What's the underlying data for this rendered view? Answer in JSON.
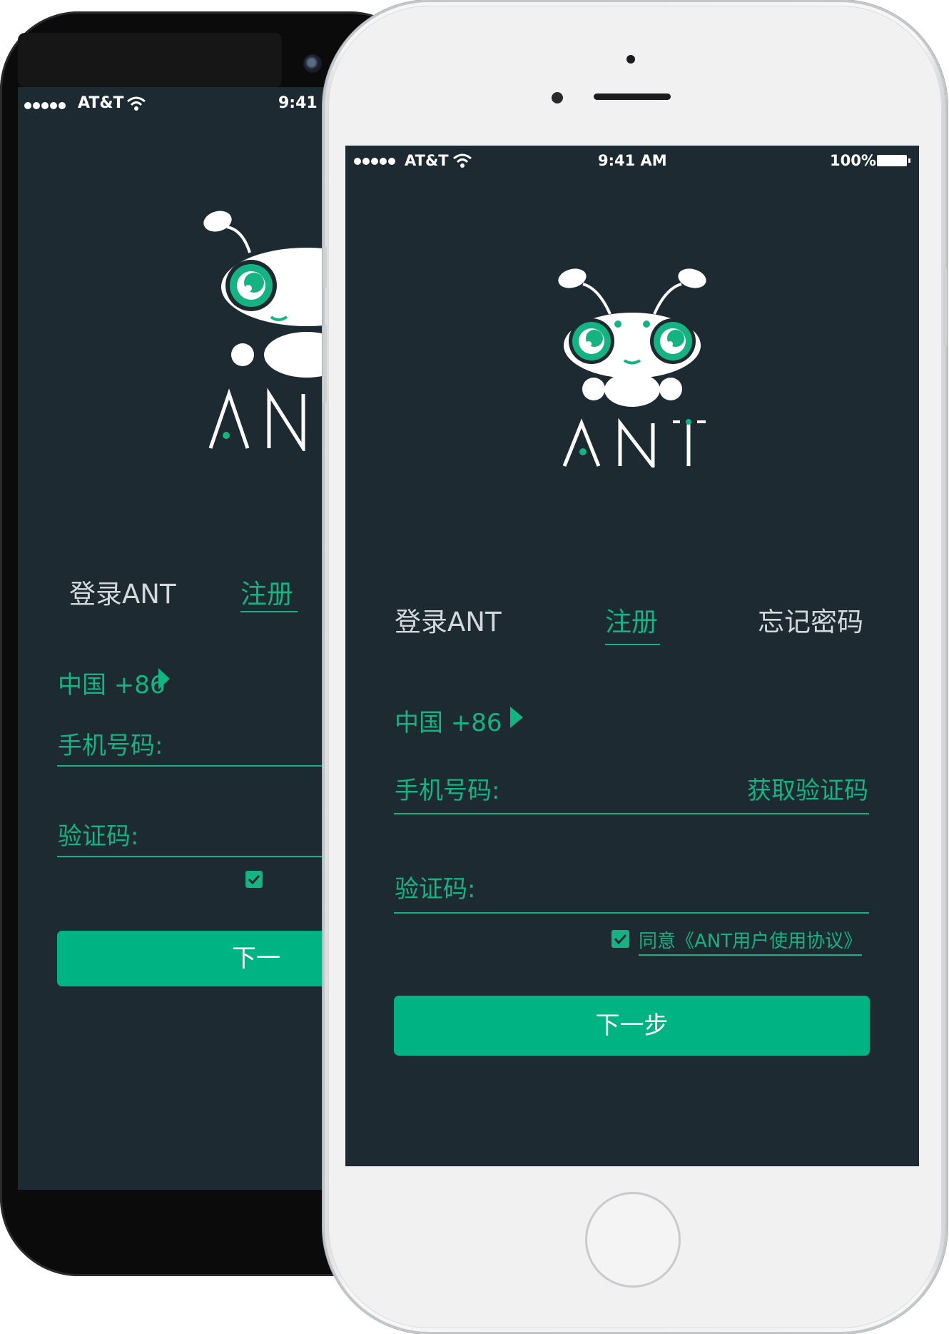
{
  "back_phone": {
    "status": {
      "carrier": "AT&T",
      "time": "9:41"
    },
    "logo_text": "AN",
    "tabs": {
      "login": "登录ANT",
      "register": "注册"
    },
    "country": "中国 +86",
    "phone_label": "手机号码:",
    "code_label": "验证码:",
    "next_button": "下一"
  },
  "front_phone": {
    "status": {
      "carrier": "AT&T",
      "time": "9:41 AM",
      "battery": "100%"
    },
    "logo_text": "ANT",
    "tabs": {
      "login": "登录ANT",
      "register": "注册",
      "forgot": "忘记密码"
    },
    "country": "中国 +86",
    "phone_label": "手机号码:",
    "get_code": "获取验证码",
    "code_label": "验证码:",
    "agree_text": "同意《ANT用户使用协议》",
    "agree_checked": true,
    "next_button": "下一步"
  },
  "colors": {
    "screen_bg": "#1d2a32",
    "accent": "#14b381",
    "button": "#00b383",
    "tab_text": "#d3d8dc"
  }
}
